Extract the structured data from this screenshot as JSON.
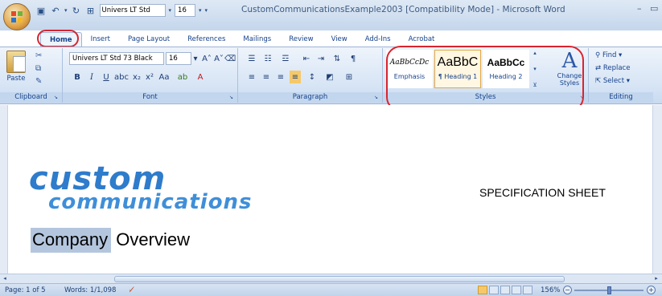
{
  "window": {
    "title": "CustomCommunicationsExample2003 [Compatibility Mode] - Microsoft Word",
    "minimize": "–",
    "restore": "▭"
  },
  "qat": {
    "font_name": "Univers LT Std",
    "font_size": "16"
  },
  "tabs": [
    {
      "label": "Home",
      "active": true
    },
    {
      "label": "Insert"
    },
    {
      "label": "Page Layout"
    },
    {
      "label": "References"
    },
    {
      "label": "Mailings"
    },
    {
      "label": "Review"
    },
    {
      "label": "View"
    },
    {
      "label": "Add-Ins"
    },
    {
      "label": "Acrobat"
    }
  ],
  "ribbon": {
    "clipboard": {
      "label": "Clipboard",
      "paste": "Paste"
    },
    "font": {
      "label": "Font",
      "font_name": "Univers LT Std 73 Black",
      "font_size": "16"
    },
    "paragraph": {
      "label": "Paragraph"
    },
    "styles": {
      "label": "Styles",
      "tiles": [
        {
          "sample": "AaBbCcDc",
          "name": "Emphasis"
        },
        {
          "sample": "AaBbC",
          "name": "¶ Heading 1",
          "selected": true
        },
        {
          "sample": "AaBbCc",
          "name": "Heading 2"
        }
      ],
      "change_styles": "Change Styles"
    },
    "editing": {
      "label": "Editing",
      "find": "Find ▾",
      "replace": "Replace",
      "select": "Select ▾"
    }
  },
  "document": {
    "logo_line1": "custom",
    "logo_line2": "communications",
    "spec_sheet": "SPECIFICATION SHEET",
    "heading_selected": "Company",
    "heading_rest": " Overview"
  },
  "status": {
    "page": "Page: 1 of 5",
    "words": "Words: 1/1,098",
    "zoom": "156%"
  },
  "colors": {
    "accent_circle": "#d9242f",
    "logo_blue": "#2e7ccb",
    "ribbon_text": "#15428b"
  }
}
